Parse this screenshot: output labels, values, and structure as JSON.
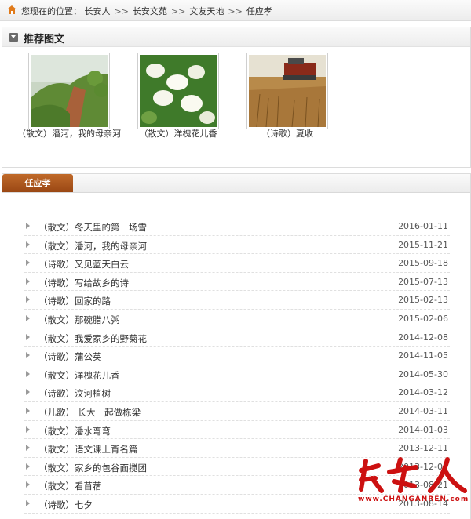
{
  "breadcrumb": {
    "prefix": "您现在的位置：",
    "items": [
      "长安人",
      "长安文苑",
      "文友天地",
      "任应孝"
    ],
    "separator": ">>"
  },
  "recommend": {
    "title": "推荐图文",
    "items": [
      {
        "caption": "（散文）潘河，我的母亲河",
        "image": "hillside-photo"
      },
      {
        "caption": "（散文）洋槐花儿香",
        "image": "locust-flower-photo"
      },
      {
        "caption": "（诗歌）夏收",
        "image": "wheat-harvest-photo"
      }
    ]
  },
  "list": {
    "tab_label": "任应孝",
    "articles": [
      {
        "title": "（散文）冬天里的第一场雪",
        "date": "2016-01-11"
      },
      {
        "title": "（散文）潘河，我的母亲河",
        "date": "2015-11-21"
      },
      {
        "title": "（诗歌）又见蓝天白云",
        "date": "2015-09-18"
      },
      {
        "title": "（诗歌）写给故乡的诗",
        "date": "2015-07-13"
      },
      {
        "title": "（诗歌）回家的路",
        "date": "2015-02-13"
      },
      {
        "title": "（散文）那碗腊八粥",
        "date": "2015-02-06"
      },
      {
        "title": "（散文）我爱家乡的野菊花",
        "date": "2014-12-08"
      },
      {
        "title": "（诗歌）蒲公英",
        "date": "2014-11-05"
      },
      {
        "title": "（散文）洋槐花儿香",
        "date": "2014-05-30"
      },
      {
        "title": "（诗歌）汶河植树",
        "date": "2014-03-12"
      },
      {
        "title": "（儿歌） 长大一起做栋梁",
        "date": "2014-03-11"
      },
      {
        "title": "（散文）潘水弯弯",
        "date": "2014-01-03"
      },
      {
        "title": "（散文）语文课上背名篇",
        "date": "2013-12-11"
      },
      {
        "title": "（散文）家乡的包谷面搅团",
        "date": "2013-12-02"
      },
      {
        "title": "（散文）看苜蓿",
        "date": "2013-08-21"
      },
      {
        "title": "（诗歌）七夕",
        "date": "2013-08-14"
      }
    ]
  },
  "watermark": {
    "logo_text": "长安人",
    "site": "www.CHANGANREN.com",
    "color": "#cc1111"
  }
}
